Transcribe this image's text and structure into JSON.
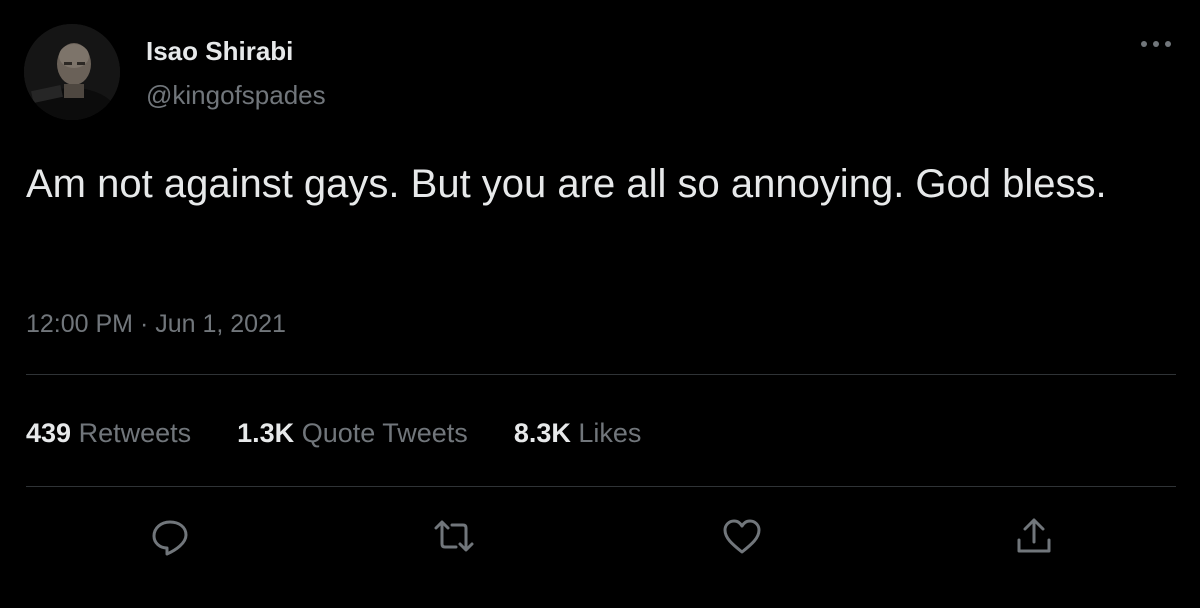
{
  "author": {
    "display_name": "Isao Shirabi",
    "handle": "@kingofspades",
    "avatar_icon": "profile-photo"
  },
  "tweet": {
    "text": "Am not against gays. But you are all so annoying. God bless.",
    "timestamp": "12:00 PM · Jun 1, 2021"
  },
  "stats": [
    {
      "count": "439",
      "label": "Retweets"
    },
    {
      "count": "1.3K",
      "label": "Quote Tweets"
    },
    {
      "count": "8.3K",
      "label": "Likes"
    }
  ],
  "actions": [
    {
      "icon": "reply-icon"
    },
    {
      "icon": "retweet-icon"
    },
    {
      "icon": "like-icon"
    },
    {
      "icon": "share-icon"
    }
  ],
  "colors": {
    "background": "#000000",
    "primary_text": "#e7e9ea",
    "secondary_text": "#71767b",
    "divider": "#2f3336"
  }
}
